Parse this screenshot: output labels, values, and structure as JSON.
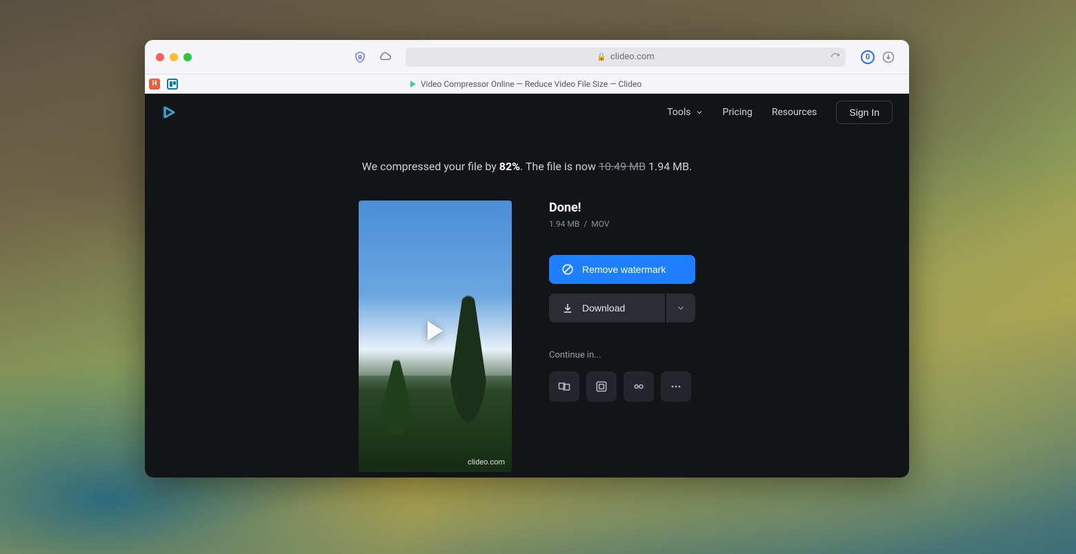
{
  "browser": {
    "url_host": "clideo.com",
    "tab_title": "Video Compressor Online — Reduce Video File Size — Clideo"
  },
  "nav": {
    "tools": "Tools",
    "pricing": "Pricing",
    "resources": "Resources",
    "signin": "Sign In"
  },
  "headline": {
    "prefix": "We compressed your file by ",
    "percent": "82%",
    "middle": ". The file is now ",
    "old_size": "10.49 MB",
    "new_size": "1.94 MB",
    "suffix": "."
  },
  "result": {
    "done": "Done!",
    "file_size": "1.94 MB",
    "file_format": "MOV",
    "watermark_host": "clideo.com",
    "remove_watermark": "Remove watermark",
    "download": "Download",
    "continue_label": "Continue in..."
  },
  "continue_icons": [
    "merge-icon",
    "resize-icon",
    "crop-icon",
    "more-icon"
  ]
}
